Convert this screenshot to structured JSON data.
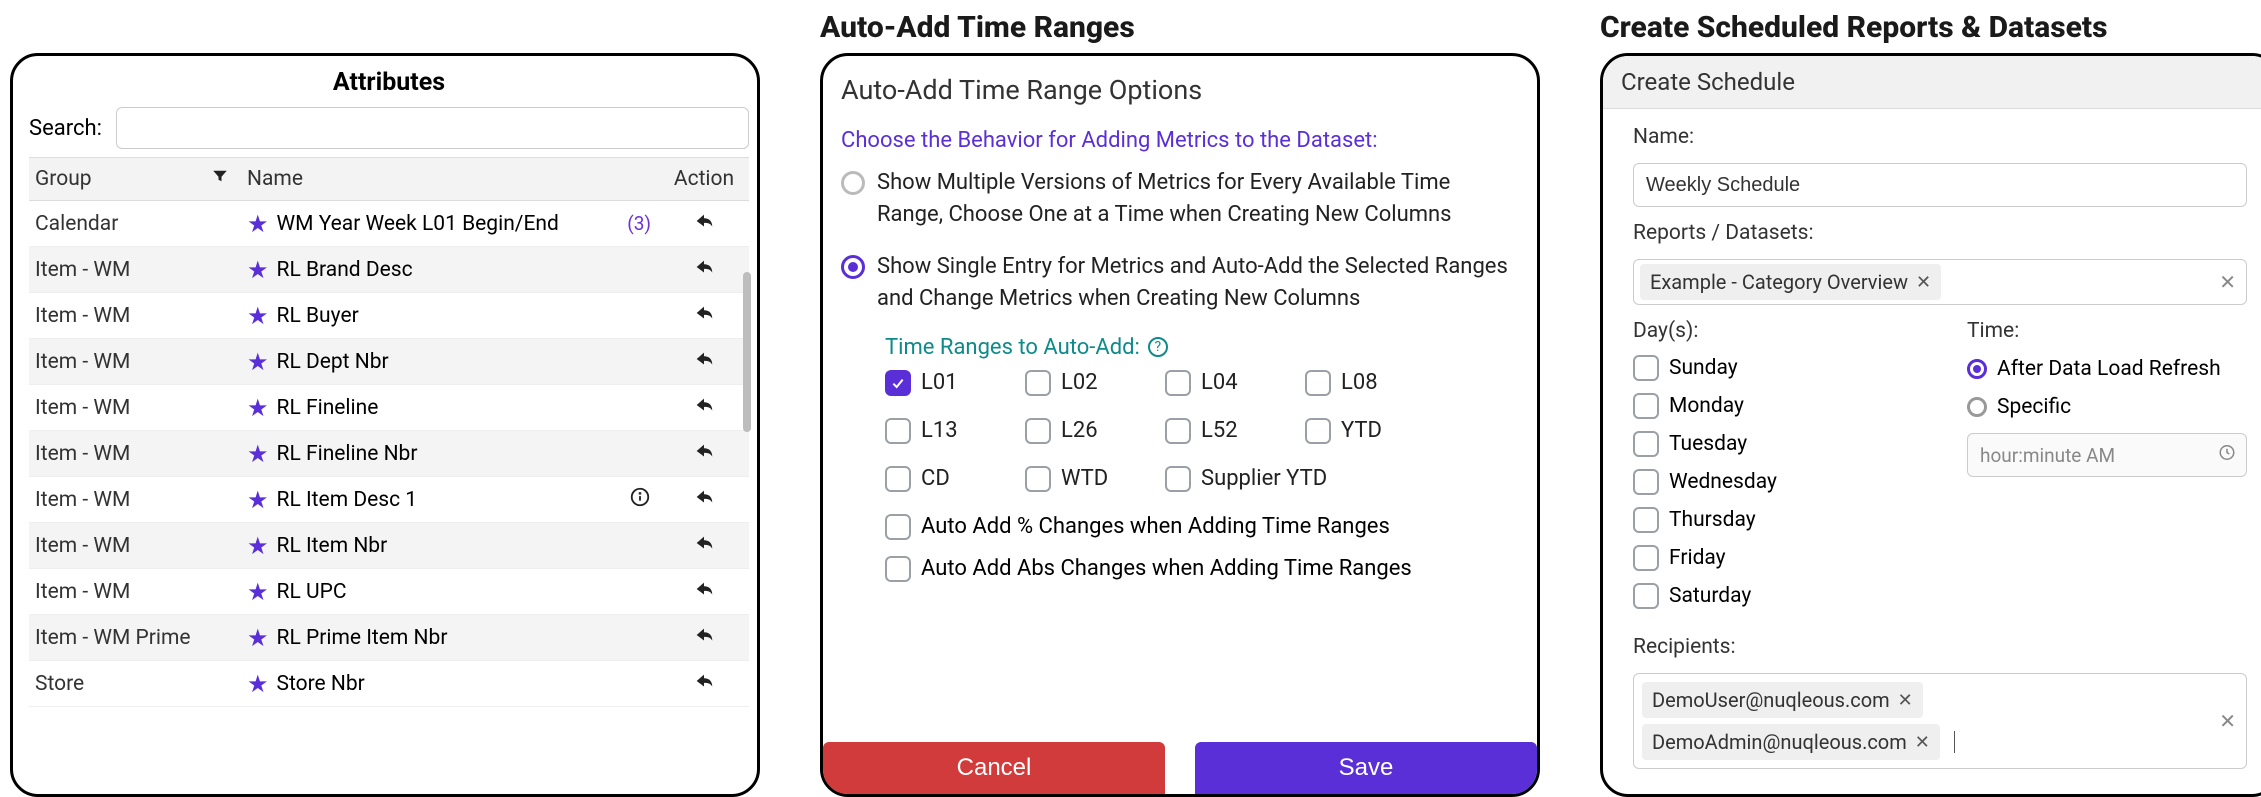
{
  "panel1": {
    "title": "Attributes",
    "search_label": "Search:",
    "header": {
      "group": "Group",
      "name": "Name",
      "action": "Action"
    },
    "rows": [
      {
        "group": "Calendar",
        "name": "WM Year Week L01 Begin/End",
        "extra_count": "(3)",
        "info": false
      },
      {
        "group": "Item - WM",
        "name": "RL Brand Desc",
        "extra_count": "",
        "info": false
      },
      {
        "group": "Item - WM",
        "name": "RL Buyer",
        "extra_count": "",
        "info": false
      },
      {
        "group": "Item - WM",
        "name": "RL Dept Nbr",
        "extra_count": "",
        "info": false
      },
      {
        "group": "Item - WM",
        "name": "RL Fineline",
        "extra_count": "",
        "info": false
      },
      {
        "group": "Item - WM",
        "name": "RL Fineline Nbr",
        "extra_count": "",
        "info": false
      },
      {
        "group": "Item - WM",
        "name": "RL Item Desc 1",
        "extra_count": "",
        "info": true
      },
      {
        "group": "Item - WM",
        "name": "RL Item Nbr",
        "extra_count": "",
        "info": false
      },
      {
        "group": "Item - WM",
        "name": "RL UPC",
        "extra_count": "",
        "info": false
      },
      {
        "group": "Item - WM Prime",
        "name": "RL Prime Item Nbr",
        "extra_count": "",
        "info": false
      },
      {
        "group": "Store",
        "name": "Store Nbr",
        "extra_count": "",
        "info": false
      }
    ]
  },
  "panel2": {
    "heading": "Auto-Add Time Ranges",
    "title": "Auto-Add Time Range Options",
    "prompt": "Choose the Behavior for Adding Metrics to the Dataset:",
    "option1": "Show Multiple Versions of Metrics for Every Available Time Range, Choose One at a Time when Creating New Columns",
    "option2": "Show Single Entry for Metrics and Auto-Add the Selected Ranges and Change Metrics when Creating New Columns",
    "tr_sub": "Time Ranges to Auto-Add:",
    "ranges": [
      {
        "label": "L01",
        "checked": true
      },
      {
        "label": "L02",
        "checked": false
      },
      {
        "label": "L04",
        "checked": false
      },
      {
        "label": "L08",
        "checked": false
      },
      {
        "label": "L13",
        "checked": false
      },
      {
        "label": "L26",
        "checked": false
      },
      {
        "label": "L52",
        "checked": false
      },
      {
        "label": "YTD",
        "checked": false
      },
      {
        "label": "CD",
        "checked": false
      },
      {
        "label": "WTD",
        "checked": false
      },
      {
        "label": "Supplier YTD",
        "checked": false,
        "wide": true
      }
    ],
    "auto_pct": "Auto Add % Changes when Adding Time Ranges",
    "auto_abs": "Auto Add Abs Changes when Adding Time Ranges",
    "cancel": "Cancel",
    "save": "Save"
  },
  "panel3": {
    "heading": "Create Scheduled Reports & Datasets",
    "title": "Create Schedule",
    "name_label": "Name:",
    "name_value": "Weekly Schedule",
    "reports_label": "Reports / Datasets:",
    "report_chip": "Example - Category Overview",
    "days_label": "Day(s):",
    "days": [
      "Sunday",
      "Monday",
      "Tuesday",
      "Wednesday",
      "Thursday",
      "Friday",
      "Saturday"
    ],
    "time_label": "Time:",
    "time_opt1": "After Data Load Refresh",
    "time_opt2": "Specific",
    "time_placeholder": "hour:minute AM",
    "recipients_label": "Recipients:",
    "recipients": [
      "DemoUser@nuqleous.com",
      "DemoAdmin@nuqleous.com"
    ]
  }
}
